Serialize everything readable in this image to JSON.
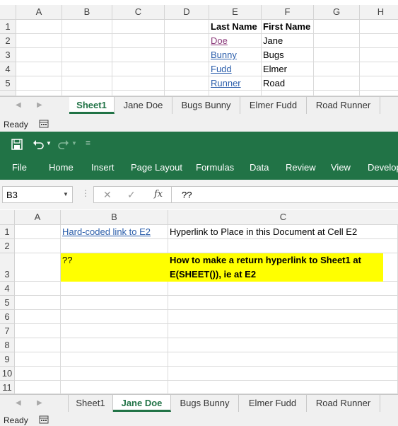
{
  "top": {
    "columns": [
      "A",
      "B",
      "C",
      "D",
      "E",
      "F",
      "G",
      "H"
    ],
    "rows": [
      "1",
      "2",
      "3",
      "4",
      "5"
    ],
    "headers": {
      "last_name": "Last Name",
      "first_name": "First Name"
    },
    "people": [
      {
        "last": "Doe",
        "first": "Jane"
      },
      {
        "last": "Bunny",
        "first": "Bugs"
      },
      {
        "last": "Fudd",
        "first": "Elmer"
      },
      {
        "last": "Runner",
        "first": "Road"
      }
    ],
    "tabs": [
      "Sheet1",
      "Jane Doe",
      "Bugs Bunny",
      "Elmer Fudd",
      "Road Runner"
    ],
    "active_tab": "Sheet1",
    "status": "Ready"
  },
  "ribbon": {
    "menu": [
      "File",
      "Home",
      "Insert",
      "Page Layout",
      "Formulas",
      "Data",
      "Review",
      "View",
      "Develop"
    ],
    "qat_more": "="
  },
  "formula_bar": {
    "name_box": "B3",
    "fx": "fx",
    "formula": "??"
  },
  "bottom": {
    "columns": [
      "A",
      "B",
      "C"
    ],
    "rows": [
      "1",
      "2",
      "3",
      "4",
      "5",
      "6",
      "7",
      "8",
      "9",
      "10",
      "11"
    ],
    "b1": "Hard-coded link to E2",
    "c1": "Hyperlink to Place in this Document at Cell E2",
    "b3": "??",
    "c3_line1": "How to make a return hyperlink to Sheet1 at",
    "c3_line2": "E(SHEET()), ie at E2",
    "tabs": [
      "Sheet1",
      "Jane Doe",
      "Bugs Bunny",
      "Elmer Fudd",
      "Road Runner"
    ],
    "active_tab": "Jane Doe",
    "status": "Ready"
  },
  "colors": {
    "excel_green": "#217346",
    "highlight_yellow": "#ffff00",
    "link": "#2b5eab",
    "visited_link": "#8b3a7a"
  }
}
